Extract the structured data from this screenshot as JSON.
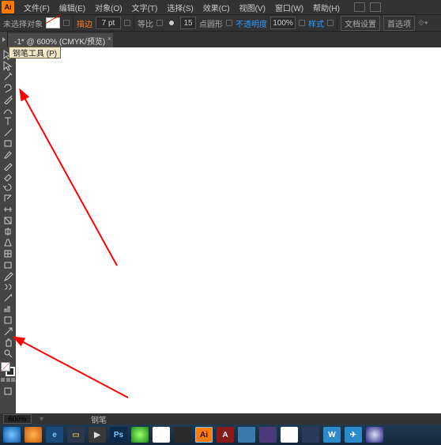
{
  "app": {
    "logo": "Ai"
  },
  "menu": {
    "items": [
      "文件(F)",
      "编辑(E)",
      "对象(O)",
      "文字(T)",
      "选择(S)",
      "效果(C)",
      "视图(V)",
      "窗口(W)",
      "帮助(H)"
    ]
  },
  "options": {
    "no_selection": "未选择对象",
    "stroke_label": "描边",
    "stroke_pt": "7 pt",
    "uniform": "等比",
    "pt_field": "15",
    "pt_label": "点圆形",
    "opacity_link": "不透明度",
    "opacity_val": "100%",
    "style": "样式",
    "doc_setup": "文档设置",
    "preferences": "首选项"
  },
  "tab": {
    "label": "-1* @ 600% (CMYK/预览)"
  },
  "tooltip": {
    "text": "钢笔工具 (P)"
  },
  "tools": [
    "selection",
    "direct-selection",
    "magic-wand",
    "lasso",
    "pen",
    "curvature",
    "type",
    "line",
    "rectangle",
    "paintbrush",
    "pencil",
    "eraser",
    "rotate",
    "scale",
    "width",
    "free-transform",
    "shape-builder",
    "perspective",
    "mesh",
    "gradient",
    "eyedropper",
    "blend",
    "symbol-sprayer",
    "column-graph",
    "artboard",
    "slice",
    "hand",
    "zoom"
  ],
  "status": {
    "zoom": "600%",
    "tool_label": "钢笔"
  },
  "taskbar": {
    "items": [
      {
        "bg": "radial-gradient(circle,#7cc3ff,#0a5aa8)",
        "txt": "",
        "name": "start"
      },
      {
        "bg": "radial-gradient(circle,#ffb35a,#cc5a00)",
        "txt": "",
        "name": "app1"
      },
      {
        "bg": "#1a4a7a",
        "txt": "e",
        "name": "ie",
        "color": "#7cc3ff"
      },
      {
        "bg": "#2a3a4a",
        "txt": "▭",
        "name": "explorer",
        "color": "#c8a85a"
      },
      {
        "bg": "#3a3a3a",
        "txt": "▶",
        "name": "media",
        "color": "#ddd"
      },
      {
        "bg": "#0b2b4d",
        "txt": "Ps",
        "name": "photoshop",
        "color": "#7cc3ff"
      },
      {
        "bg": "radial-gradient(circle,#9cff6a,#1a8a1a)",
        "txt": "",
        "name": "app2"
      },
      {
        "bg": "#fff",
        "txt": "",
        "name": "chrome-like"
      },
      {
        "bg": "#2a2a2a",
        "txt": "",
        "name": "app3"
      },
      {
        "bg": "#ff7c00",
        "txt": "Ai",
        "name": "illustrator",
        "color": "#2b0000",
        "active": true
      },
      {
        "bg": "#8a1a1a",
        "txt": "A",
        "name": "acrobat",
        "color": "#fff"
      },
      {
        "bg": "#3a7aaa",
        "txt": "",
        "name": "app4"
      },
      {
        "bg": "#4a3a7a",
        "txt": "",
        "name": "app5"
      },
      {
        "bg": "#fff",
        "txt": "",
        "name": "chrome"
      },
      {
        "bg": "#2a3a5a",
        "txt": "",
        "name": "firefox"
      },
      {
        "bg": "#2a8aca",
        "txt": "W",
        "name": "word",
        "color": "#fff"
      },
      {
        "bg": "#2a8aca",
        "txt": "✈",
        "name": "app6",
        "color": "#fff"
      },
      {
        "bg": "radial-gradient(circle,#dde,#228)",
        "txt": "",
        "name": "app7"
      }
    ]
  }
}
